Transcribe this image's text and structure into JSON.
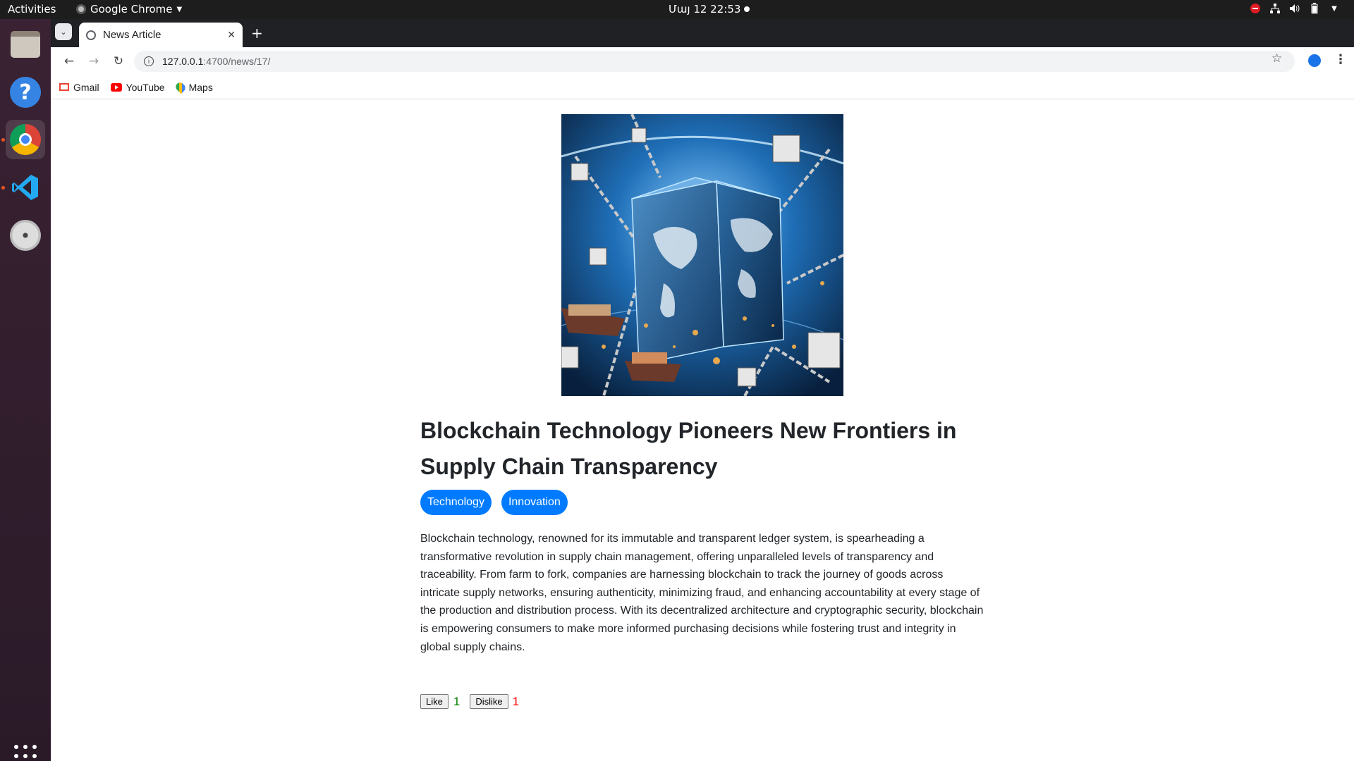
{
  "system": {
    "activities": "Activities",
    "app_name": "Google Chrome",
    "clock": "Մայ 12  22:53"
  },
  "dock": {
    "items": [
      "files-icon",
      "help-icon",
      "chrome-icon",
      "vscode-icon",
      "dvd-icon",
      "apps-grid-icon"
    ]
  },
  "browser": {
    "tab_title": "News Article",
    "url_host": "127.0.0.1",
    "url_path": ":4700/news/17/",
    "bookmarks": [
      {
        "label": "Gmail",
        "icon": "gmail-icon"
      },
      {
        "label": "YouTube",
        "icon": "youtube-icon"
      },
      {
        "label": "Maps",
        "icon": "maps-icon"
      }
    ]
  },
  "article": {
    "image_alt": "blockchain cube over world map with chains and cargo ships",
    "title": "Blockchain Technology Pioneers New Frontiers in Supply Chain Transparency",
    "tags": [
      "Technology",
      "Innovation"
    ],
    "body": "Blockchain technology, renowned for its immutable and transparent ledger system, is spearheading a transformative revolution in supply chain management, offering unparalleled levels of transparency and traceability. From farm to fork, companies are harnessing blockchain to track the journey of goods across intricate supply networks, ensuring authenticity, minimizing fraud, and enhancing accountability at every stage of the production and distribution process. With its decentralized architecture and cryptographic security, blockchain is empowering consumers to make more informed purchasing decisions while fostering trust and integrity in global supply chains.",
    "like_label": "Like",
    "like_count": "1",
    "dislike_label": "Dislike",
    "dislike_count": "1"
  },
  "colors": {
    "tag_bg": "#007bff",
    "like_count": "#008000",
    "dislike_count": "#ff0000"
  }
}
